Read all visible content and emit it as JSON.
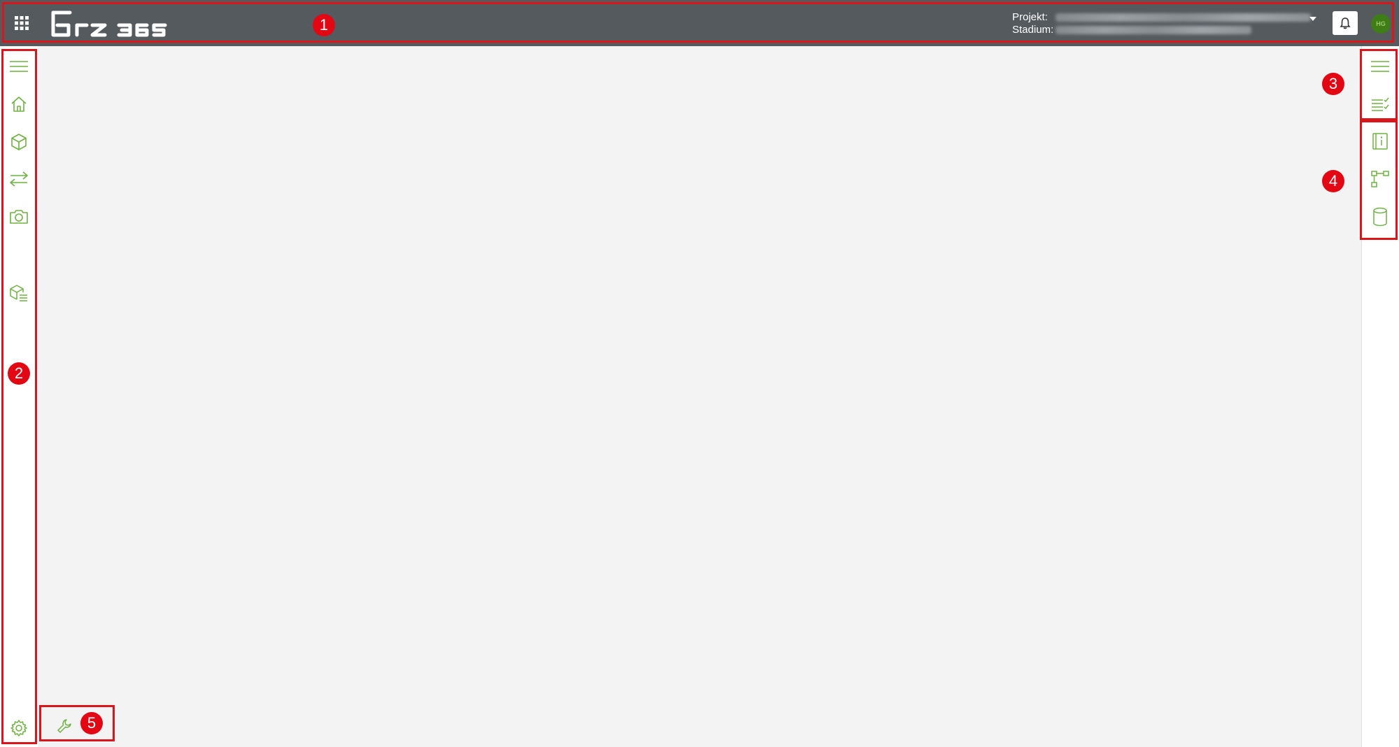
{
  "header": {
    "apps_icon": "apps-grid-icon",
    "logo_text": "brz 365",
    "project_label": "Projekt:",
    "stage_label": "Stadium:",
    "notifications_icon": "bell-icon",
    "avatar_initials": "HG"
  },
  "left_sidebar": {
    "items": [
      {
        "icon": "menu-icon"
      },
      {
        "icon": "home-icon"
      },
      {
        "icon": "cube-icon"
      },
      {
        "icon": "transfer-arrows-icon"
      },
      {
        "icon": "camera-icon"
      },
      {
        "icon": "cube-list-icon"
      },
      {
        "icon": "gear-icon"
      }
    ]
  },
  "right_sidebar": {
    "group_top": [
      {
        "icon": "menu-icon"
      },
      {
        "icon": "checklist-icon"
      }
    ],
    "group_bottom": [
      {
        "icon": "info-book-icon"
      },
      {
        "icon": "hierarchy-icon"
      },
      {
        "icon": "database-icon"
      }
    ]
  },
  "tools": {
    "icon": "wrench-icon"
  },
  "markers": [
    "1",
    "2",
    "3",
    "4",
    "5"
  ],
  "colors": {
    "accent": "#6db33f",
    "topbar": "#555a5e",
    "highlight": "#d9161b",
    "marker": "#e30613"
  }
}
